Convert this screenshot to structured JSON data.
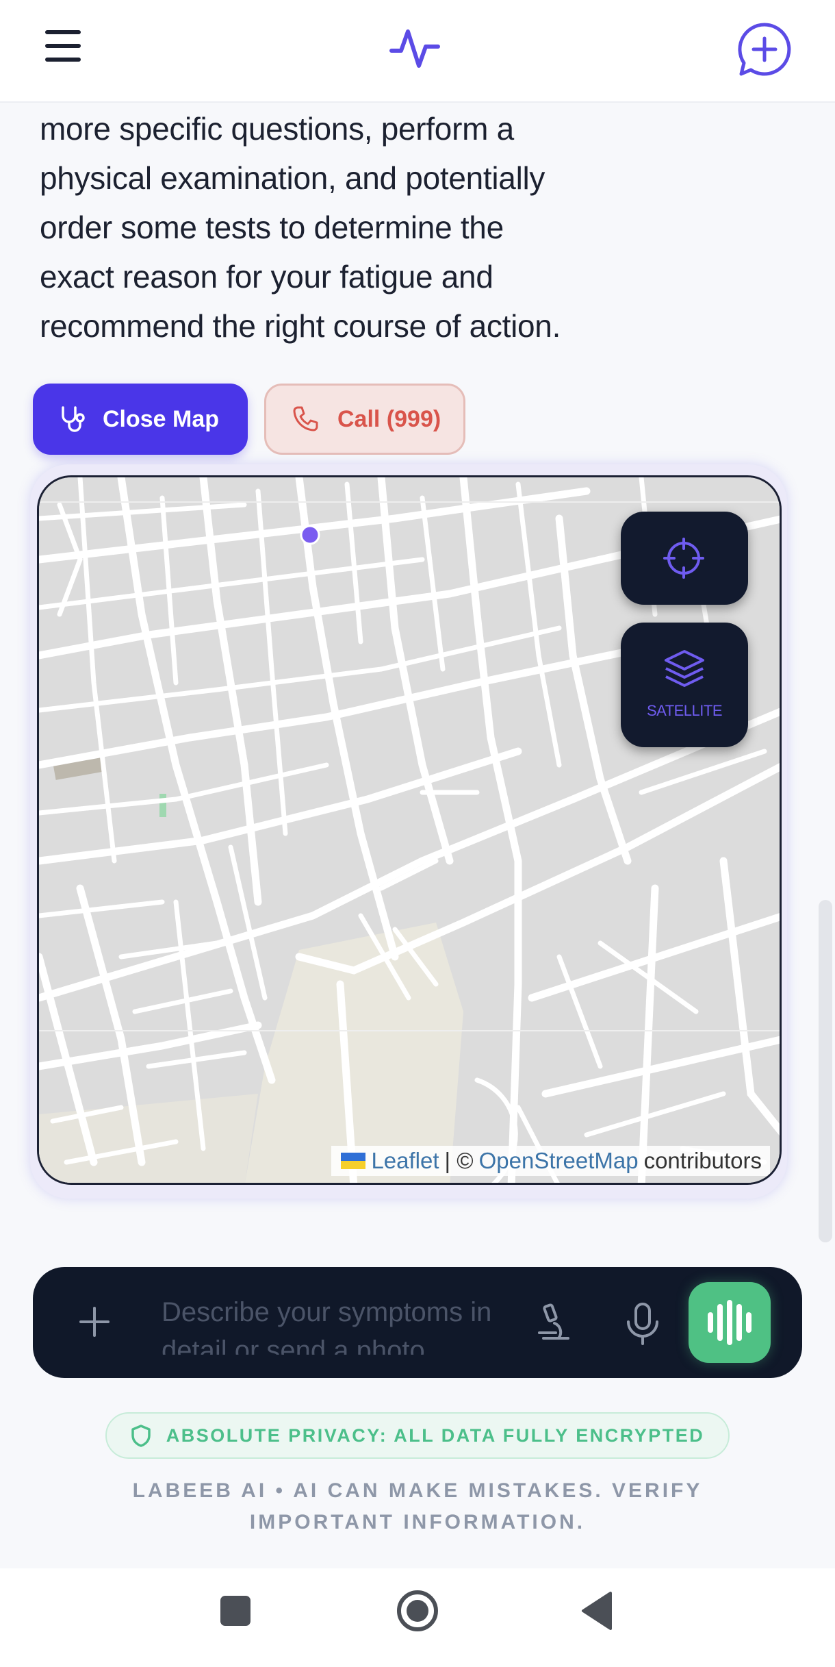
{
  "header": {
    "menu_icon": "hamburger-menu-icon",
    "logo_icon": "pulse-icon",
    "new_chat_icon": "chat-plus-icon"
  },
  "message": {
    "lines": [
      "more specific questions, perform a",
      "physical examination, and potentially",
      "order some tests to determine the",
      "exact reason for your fatigue and",
      "recommend the right course of action."
    ]
  },
  "actions": {
    "close_map_label": "Close Map",
    "close_map_icon": "stethoscope-icon",
    "call_label": "Call (999)",
    "call_icon": "phone-icon"
  },
  "map": {
    "locate_icon": "crosshair-icon",
    "layers_icon": "layers-icon",
    "layers_label": "SATELLITE",
    "attribution": {
      "leaflet": "Leaflet",
      "separator": "| ©",
      "osm": "OpenStreetMap",
      "contributors": "contributors"
    }
  },
  "composer": {
    "plus_icon": "plus-icon",
    "placeholder": "Describe your symptoms in detail or send a photo",
    "microscope_icon": "microscope-icon",
    "mic_icon": "microphone-icon",
    "voice_icon": "voice-wave-icon"
  },
  "footer": {
    "privacy_text": "ABSOLUTE PRIVACY: ALL DATA FULLY ENCRYPTED",
    "privacy_icon": "shield-icon",
    "disclaimer": "LABEEB AI • AI CAN MAKE MISTAKES. VERIFY IMPORTANT INFORMATION."
  },
  "colors": {
    "accent": "#4a36e8",
    "call": "#d9544b",
    "composer_bg": "#101829",
    "voice_green": "#4fc184",
    "privacy_green": "#4cbf8a"
  }
}
